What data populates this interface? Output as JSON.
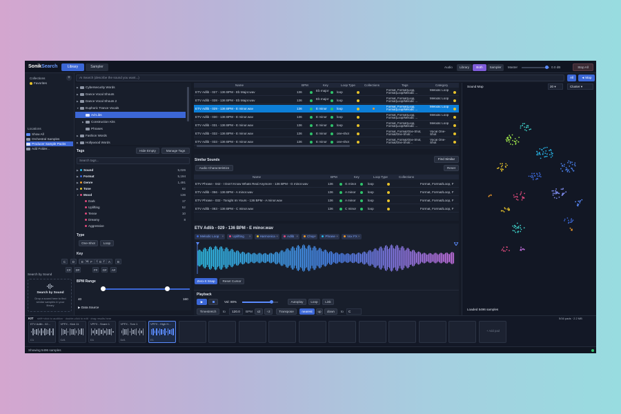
{
  "app": {
    "logo_a": "Sonik",
    "logo_b": "Search",
    "tabs": [
      "Library",
      "Sampler"
    ],
    "audio_label": "Audio",
    "audio_modes": [
      "Library",
      "Both",
      "Sampler"
    ],
    "master_label": "Master",
    "master_value": "0.0 dB",
    "stop_all": "Stop All"
  },
  "sidebar": {
    "collections_title": "Collections",
    "add": "+",
    "collections": [
      "Favorites"
    ],
    "locations_title": "Locations",
    "locations": [
      "Show All",
      "Orchestral Samples",
      "Producer Sample Packs",
      "Add Folder..."
    ],
    "search_by_sound_title": "Search by Sound",
    "drop_title": "Search by Sound",
    "drop_text": "Drop a sound here to find similar samples in your library"
  },
  "search": {
    "placeholder": "AI Search (describe the sound you want...)",
    "all": "All",
    "map": "◄ Map"
  },
  "folders": [
    {
      "name": "Cybersecurity Words",
      "indent": 0,
      "arrow": "▶"
    },
    {
      "name": "Dance Vocal Shouts",
      "indent": 0,
      "arrow": "▶"
    },
    {
      "name": "Dance Vocal Shouts 2",
      "indent": 0,
      "arrow": "▶"
    },
    {
      "name": "Euphoric Trance Vocals",
      "indent": 0,
      "arrow": "▼"
    },
    {
      "name": "Ad-Libs",
      "indent": 1,
      "arrow": ""
    },
    {
      "name": "Construction Kits",
      "indent": 1,
      "arrow": "▶"
    },
    {
      "name": "Phrases",
      "indent": 1,
      "arrow": ""
    },
    {
      "name": "Fashion Words",
      "indent": 0,
      "arrow": "▶"
    },
    {
      "name": "Hollywood Words",
      "indent": 0,
      "arrow": "▶"
    }
  ],
  "tags": {
    "title": "Tags",
    "hide_empty": "Hide Empty",
    "manage": "Manage Tags",
    "search_placeholder": "Search tags...",
    "items": [
      {
        "name": "Sound",
        "count": "5,026",
        "color": "#27b6e8",
        "bold": true,
        "arrow": "▶"
      },
      {
        "name": "Format",
        "count": "5,194",
        "color": "#3c67d6",
        "bold": true,
        "arrow": "▶"
      },
      {
        "name": "Genre",
        "count": "1,491",
        "color": "#f09a2a",
        "bold": true,
        "arrow": "▶"
      },
      {
        "name": "Tone",
        "count": "62",
        "color": "#e8c32a",
        "bold": true,
        "arrow": "▶"
      },
      {
        "name": "Mood",
        "count": "136",
        "color": "#e04a7c",
        "bold": true,
        "arrow": "▼"
      },
      {
        "name": "Dark",
        "count": "17",
        "color": "#e04a7c",
        "bold": false,
        "arrow": ""
      },
      {
        "name": "Uplifting",
        "count": "52",
        "color": "#e04a7c",
        "bold": false,
        "arrow": ""
      },
      {
        "name": "Tense",
        "count": "10",
        "color": "#e04a7c",
        "bold": false,
        "arrow": ""
      },
      {
        "name": "Dreamy",
        "count": "8",
        "color": "#e04a7c",
        "bold": false,
        "arrow": ""
      },
      {
        "name": "Aggressive",
        "count": "",
        "color": "#e04a7c",
        "bold": false,
        "arrow": ""
      }
    ]
  },
  "filters": {
    "type_title": "Type",
    "types": [
      "One-Shot",
      "Loop"
    ],
    "key_title": "Key",
    "key_modes": [
      "Minor",
      "Major"
    ],
    "keys_row1": [
      "C",
      "D",
      "E",
      "F",
      "G",
      "A",
      "B"
    ],
    "keys_row2": [
      "C#",
      "D#",
      "F#",
      "G#",
      "A#"
    ],
    "bpm_title": "BPM Range",
    "bpm_min": "40",
    "bpm_max": "160"
  },
  "results": {
    "columns": [
      "Name",
      "BPM",
      "Key",
      "Loop Type",
      "Collections",
      "Tags",
      "Category"
    ],
    "rows": [
      {
        "name": "ETV Adlib - 027 - 136 BPM - Eb Major.wav",
        "bpm": "136",
        "key": "Eb major",
        "loop": "loop",
        "tags": "Format, Format|Loop, Format|Loop/Melodic ...",
        "cat": "Melodic Loop",
        "sel": false
      },
      {
        "name": "ETV Adlib - 028 - 136 BPM - Eb Major.wav",
        "bpm": "136",
        "key": "Eb major",
        "loop": "loop",
        "tags": "Format, Format|Loop, Format|Loop/Melodic ...",
        "cat": "Melodic Loop",
        "sel": false
      },
      {
        "name": "ETV Adlib - 029 - 136 BPM - E minor.wav",
        "bpm": "136",
        "key": "E minor",
        "loop": "loop",
        "tags": "Format, Format|Loop, Format|Loop/Melodic ...",
        "cat": "Melodic Loop",
        "sel": true
      },
      {
        "name": "ETV Adlib - 030 - 136 BPM - E minor.wav",
        "bpm": "136",
        "key": "E minor",
        "loop": "loop",
        "tags": "Format, Format|Loop, Format|Loop/Melodic ...",
        "cat": "Melodic Loop",
        "sel": false
      },
      {
        "name": "ETV Adlib - 031 - 136 BPM - E minor.wav",
        "bpm": "136",
        "key": "E minor",
        "loop": "loop",
        "tags": "Format, Format|Loop, Format|Loop/Melodic ...",
        "cat": "Melodic Loop",
        "sel": false
      },
      {
        "name": "ETV Adlib - 032 - 136 BPM - E minor.wav",
        "bpm": "136",
        "key": "E minor",
        "loop": "one-shot",
        "tags": "Format, Format/One-Shot, Format/One-Shot/...",
        "cat": "Vocal One-Shot",
        "sel": false
      },
      {
        "name": "ETV Adlib - 033 - 136 BPM - E minor.wav",
        "bpm": "136",
        "key": "E minor",
        "loop": "one-shot",
        "tags": "Format, Format/One-Shot, Format/One-Shot/...",
        "cat": "Vocal One-Shot",
        "sel": false
      }
    ]
  },
  "similar": {
    "title": "Similar Sounds",
    "find": "Find Similar",
    "audio_char": "Audio Characteristics",
    "reset": "Reset",
    "columns": [
      "Name",
      "BPM",
      "Key",
      "Loop Type",
      "Collections"
    ],
    "rows": [
      {
        "name": "ETV Phrase - 042 - I Don't Know Whats Real Anymore - 136 BPM - G minor.wav",
        "bpm": "136",
        "key": "G minor",
        "loop": "loop",
        "tags": "Format, Format/Loop, F"
      },
      {
        "name": "ETV Adlib - 056 - 136 BPM - A minor.wav",
        "bpm": "136",
        "key": "A minor",
        "loop": "loop",
        "tags": "Format, Format/Loop, F"
      },
      {
        "name": "ETV Phrase - 032 - Tonight Im Yours - 136 BPM - A minor.wav",
        "bpm": "136",
        "key": "A minor",
        "loop": "loop",
        "tags": "Format, Format/Loop, F"
      },
      {
        "name": "ETV Adlib - 063 - 136 BPM - C minor.wav",
        "bpm": "136",
        "key": "C minor",
        "loop": "loop",
        "tags": "Format, Format/Loop, F"
      }
    ]
  },
  "detail": {
    "filename": "ETV Adlib - 029 - 136 BPM - E minor.wav",
    "tags": [
      {
        "label": "Melodic Loop",
        "color": "#3c67d6"
      },
      {
        "label": "Uplifting",
        "color": "#e04a7c"
      },
      {
        "label": "Harmonica",
        "color": "#e8c32a"
      },
      {
        "label": "Adlib",
        "color": "#e04a7c"
      },
      {
        "label": "Chop",
        "color": "#f09a2a"
      },
      {
        "label": "Phrase",
        "color": "#27b6e8"
      },
      {
        "label": "Vox FX",
        "color": "#f09a2a"
      }
    ],
    "zero_x": "Zero-X Snap",
    "reset_cursor": "Reset Cursor"
  },
  "playback": {
    "title": "Playback",
    "vol_label": "Vol: 80%",
    "vol_level": 0.8,
    "autoplay": "Autoplay",
    "loop": "Loop",
    "link": "Link",
    "timestretch": "Timestretch",
    "to": "to",
    "bpm_value": "120.0",
    "bpm_label": "BPM",
    "x2": "x2",
    "div2": "÷2",
    "transpose": "Transpose",
    "nearest": "nearest",
    "up": "up",
    "down": "down",
    "transpose_value": "C"
  },
  "map": {
    "title": "Sound Map",
    "count": "20",
    "mode": "Cluster",
    "loaded": "Loaded 5496 samples"
  },
  "sampler": {
    "kit_label": "KIT",
    "hint": "shift+click to audition · double-click to edit · drag results here",
    "data_source": "Data Source",
    "pads_info": "5/16 pads · 2.2 MB",
    "add_pad": "+ Add pad",
    "pads": [
      {
        "label": "ETV Adlib - 02...",
        "key": "C1"
      },
      {
        "label": "VPFX - Kick 11",
        "key": "C#1"
      },
      {
        "label": "VPFX - Snare 1",
        "key": "D1"
      },
      {
        "label": "VPFX - Tom 1",
        "key": "D#1"
      },
      {
        "label": "VPFX - High H...",
        "key": "E1"
      }
    ]
  },
  "status": {
    "text": "Showing 5496 samples"
  }
}
